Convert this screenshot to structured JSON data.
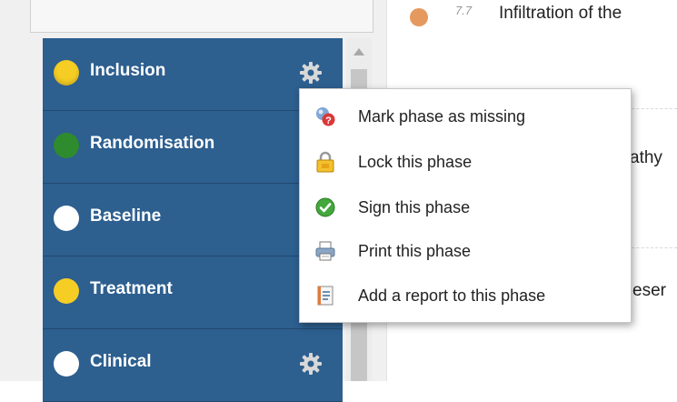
{
  "colors": {
    "phase_bg": "#2d5f8f",
    "status_yellow": "#f5cd25",
    "status_green": "#2e8b2e",
    "status_white": "#ffffff",
    "item_orange": "#e5995e"
  },
  "phases": [
    {
      "label": "Inclusion",
      "status": "yellow"
    },
    {
      "label": "Randomisation",
      "status": "green"
    },
    {
      "label": "Baseline",
      "status": "white"
    },
    {
      "label": "Treatment",
      "status": "yellow"
    },
    {
      "label": "Clinical",
      "status": "white"
    }
  ],
  "right_panel": {
    "item_number": "7.7",
    "item_text": "Infiltration of the",
    "partial_text_1": "athy",
    "partial_text_2": "eser"
  },
  "context_menu": {
    "items": [
      {
        "label": "Mark phase as missing",
        "icon": "missing-icon"
      },
      {
        "label": "Lock this phase",
        "icon": "lock-icon"
      },
      {
        "label": "Sign this phase",
        "icon": "check-icon"
      },
      {
        "label": "Print this phase",
        "icon": "printer-icon"
      },
      {
        "label": "Add a report to this phase",
        "icon": "report-icon"
      }
    ]
  }
}
